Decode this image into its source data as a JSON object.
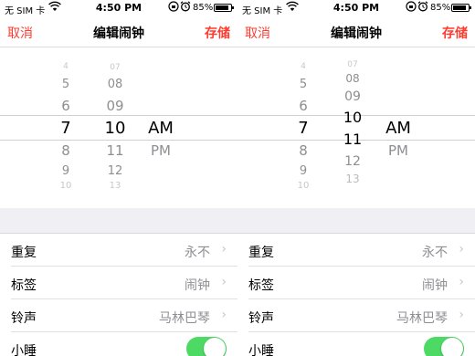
{
  "status": {
    "carrier": "无 SIM 卡",
    "time": "4:50 PM",
    "battery": "85%"
  },
  "nav": {
    "cancel": "取消",
    "title": "编辑闹钟",
    "save": "存储"
  },
  "left_picker": {
    "hours": [
      "4",
      "5",
      "6",
      "7",
      "8",
      "9",
      "10"
    ],
    "minutes": [
      "07",
      "08",
      "09",
      "10",
      "11",
      "12",
      "13"
    ],
    "ampm": [
      "AM",
      "PM"
    ]
  },
  "right_picker": {
    "hours": [
      "4",
      "5",
      "6",
      "7",
      "8",
      "9",
      "10"
    ],
    "minutes": [
      "07",
      "08",
      "09",
      "10",
      "11",
      "12",
      "13"
    ],
    "ampm": [
      "AM",
      "PM"
    ]
  },
  "settings": {
    "repeat": {
      "label": "重复",
      "value": "永不"
    },
    "tag": {
      "label": "标签",
      "value": "闹钟"
    },
    "sound": {
      "label": "铃声",
      "value": "马林巴琴"
    },
    "snooze": {
      "label": "小睡",
      "enabled": true
    }
  },
  "icons": {
    "wifi": "wifi-icon",
    "lock": "rotation-lock-icon",
    "alarm": "alarm-clock-icon",
    "battery": "battery-icon",
    "chevron": "chevron-right-icon"
  },
  "colors": {
    "accent": "#ff3b30",
    "toggle_on": "#4cd964"
  }
}
